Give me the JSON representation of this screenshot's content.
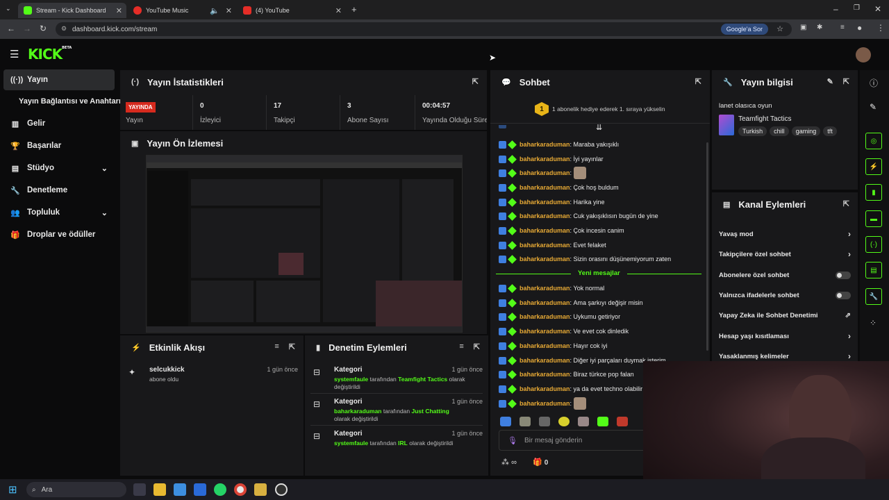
{
  "browser": {
    "tabs": [
      {
        "title": "Stream - Kick Dashboard",
        "color": "#53fc18"
      },
      {
        "title": "YouTube Music",
        "color": "#e52d27"
      },
      {
        "title": "(4) YouTube",
        "color": "#e52d27"
      }
    ],
    "url": "dashboard.kick.com/stream",
    "google_button": "Google'a Sor"
  },
  "app": {
    "logo": "KICK",
    "logo_tag": "BETA"
  },
  "sidebar": {
    "items": [
      {
        "label": "Yayın",
        "icon": "broadcast-icon"
      },
      {
        "label": "Yayın Bağlantısı ve Anahtarı",
        "icon": ""
      },
      {
        "label": "Gelir",
        "icon": "revenue-icon"
      },
      {
        "label": "Başarılar",
        "icon": "trophy-icon"
      },
      {
        "label": "Stüdyo",
        "icon": "studio-icon"
      },
      {
        "label": "Denetleme",
        "icon": "wrench-icon"
      },
      {
        "label": "Topluluk",
        "icon": "community-icon"
      },
      {
        "label": "Droplar ve ödüller",
        "icon": "gift-icon"
      }
    ]
  },
  "stats": {
    "title": "Yayın İstatistikleri",
    "live_badge": "YAYINDA",
    "live_label": "Yayın",
    "items": [
      {
        "value": "0",
        "label": "İzleyici"
      },
      {
        "value": "17",
        "label": "Takipçi"
      },
      {
        "value": "3",
        "label": "Abone Sayısı"
      },
      {
        "value": "00:04:57",
        "label": "Yayında Olduğu Süre"
      }
    ]
  },
  "preview": {
    "title": "Yayın Ön İzlemesi"
  },
  "activity": {
    "title": "Etkinlik Akışı",
    "items": [
      {
        "user": "selcukkick",
        "desc": "abone oldu",
        "time": "1 gün önce"
      }
    ]
  },
  "modlog": {
    "title": "Denetim Eylemleri",
    "items": [
      {
        "title": "Kategori",
        "user": "systemfaule",
        "mid": " tarafından ",
        "target": "Teamfight Tactics",
        "tail": " olarak değiştirildi",
        "time": "1 gün önce"
      },
      {
        "title": "Kategori",
        "user": "baharkaraduman",
        "mid": " tarafından ",
        "target": "Just Chatting",
        "tail": " olarak değiştirildi",
        "time": "1 gün önce"
      },
      {
        "title": "Kategori",
        "user": "systemfaule",
        "mid": " tarafından ",
        "target": "IRL",
        "tail": " olarak değiştirildi",
        "time": "1 gün önce"
      }
    ]
  },
  "chat": {
    "title": "Sohbet",
    "banner": "1 abonelik hediye ederek 1. sıraya yükselin",
    "banner_rank": "1",
    "username": "baharkaraduman",
    "messages_old": [
      "Maraba yakışıklı",
      "İyi yayınlar",
      "",
      "Çok hoş buldum",
      "Harika yine",
      "Cuk yakışıklısın bugün de yine",
      "Çok incesin canim",
      "Evet felaket",
      "Sizin orasını düşünemiyorum zaten"
    ],
    "new_divider": "Yeni mesajlar",
    "messages_new": [
      "Yok normal",
      "Ama şarkıyı değişir misin",
      "Uykumu getiriyor",
      "Ve evet cok dinledik",
      "Hayır cok iyi",
      "Diğer iyi parçaları duymak isterim",
      "Biraz türkce pop falan",
      "ya da evet techno olabilir",
      ""
    ],
    "input_placeholder": "Bir mesaj gönderin",
    "infinity": "∞",
    "gift_count": "0"
  },
  "streaminfo": {
    "title": "Yayın bilgisi",
    "stream_title": "lanet olasıca oyun",
    "category": "Teamfight Tactics",
    "tags": [
      "Turkish",
      "chill",
      "gaming",
      "tft"
    ]
  },
  "channel_actions": {
    "title": "Kanal Eylemleri",
    "rows": [
      {
        "label": "Yavaş mod",
        "kind": "chevron"
      },
      {
        "label": "Takipçilere özel sohbet",
        "kind": "chevron"
      },
      {
        "label": "Abonelere özel sohbet",
        "kind": "toggle"
      },
      {
        "label": "Yalnızca ifadelerle sohbet",
        "kind": "toggle"
      },
      {
        "label": "Yapay Zeka ile Sohbet Denetimi",
        "kind": "external"
      },
      {
        "label": "Hesap yaşı kısıtlaması",
        "kind": "chevron"
      },
      {
        "label": "Yasaklanmış kelimeler",
        "kind": "chevron"
      }
    ]
  },
  "taskbar": {
    "search": "Ara"
  },
  "colors": {
    "accent": "#53fc18",
    "username": "#e6a935",
    "live": "#d62a1e"
  }
}
